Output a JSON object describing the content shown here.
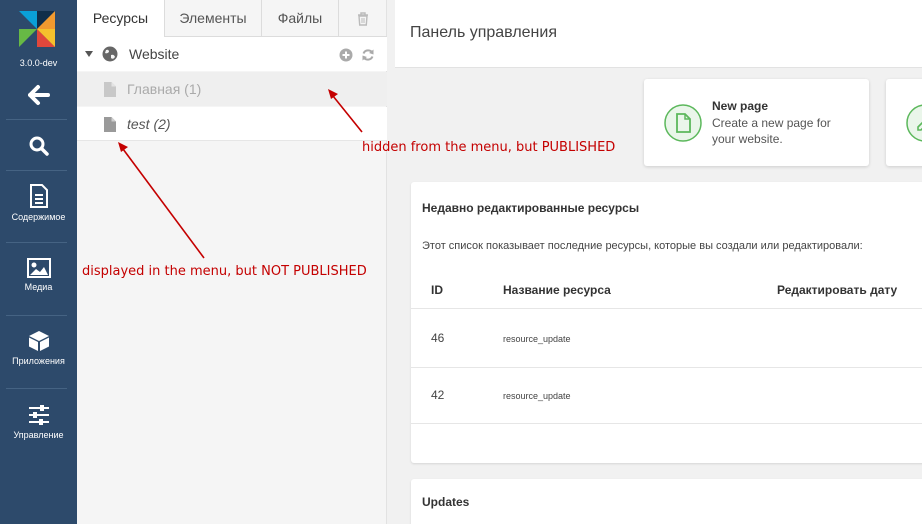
{
  "sidebar": {
    "version": "3.0.0-dev",
    "items": [
      {
        "label": "Содержимое",
        "icon": "document-icon"
      },
      {
        "label": "Медиа",
        "icon": "image-icon"
      },
      {
        "label": "Приложения",
        "icon": "box-icon"
      },
      {
        "label": "Управление",
        "icon": "sliders-icon"
      }
    ]
  },
  "tree": {
    "tabs": [
      "Ресурсы",
      "Элементы",
      "Файлы"
    ],
    "root_label": "Website",
    "items": [
      {
        "label": "Главная (1)"
      },
      {
        "label": "test (2)"
      }
    ]
  },
  "header": {
    "title": "Панель управления"
  },
  "new_page": {
    "title": "New page",
    "description": "Create a new page for your website."
  },
  "recent": {
    "title": "Недавно редактированные ресурсы",
    "description": "Этот список показывает последние ресурсы, которые вы создали или редактировали:",
    "columns": [
      "ID",
      "Название ресурса",
      "Редактировать дату"
    ],
    "rows": [
      {
        "id": "46",
        "name": "resource_update"
      },
      {
        "id": "42",
        "name": "resource_update"
      }
    ]
  },
  "updates": {
    "title": "Updates"
  },
  "annotations": {
    "hidden": "hidden from the menu, but PUBLISHED",
    "displayed": "displayed in the menu, but NOT PUBLISHED"
  },
  "colors": {
    "sidebar_bg": "#2d4a6b",
    "accent_green": "#5cb85c",
    "annotation_red": "#c40000"
  }
}
